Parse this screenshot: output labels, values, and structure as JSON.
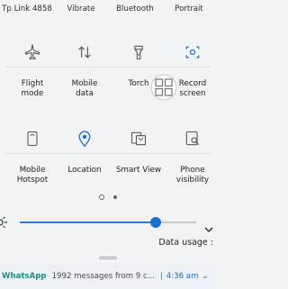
{
  "top_labels": [
    "Tp Link 4858",
    "Vibrate",
    "Bluetooth",
    "Portrait"
  ],
  "tiles": [
    {
      "label": "Flight\nmode",
      "icon": "airplane-icon"
    },
    {
      "label": "Mobile\ndata",
      "icon": "data-arrows-icon"
    },
    {
      "label": "Torch",
      "icon": "torch-icon"
    },
    {
      "label": "Record\nscreen",
      "icon": "record-screen-icon"
    },
    {
      "label": "Mobile\nHotspot",
      "icon": "hotspot-icon"
    },
    {
      "label": "Location",
      "icon": "location-icon"
    },
    {
      "label": "Smart View",
      "icon": "smart-view-icon"
    },
    {
      "label": "Phone\nvisibility",
      "icon": "phone-visibility-icon"
    }
  ],
  "brightness": {
    "level": 0.77
  },
  "data_usage_label": "Data usage :",
  "notification": {
    "app": "WhatsApp",
    "message": "1992 messages from 9 c...",
    "time": "4:36 am"
  },
  "colors": {
    "accent": "#1d6fcf",
    "whatsapp": "#1f8f7a"
  }
}
